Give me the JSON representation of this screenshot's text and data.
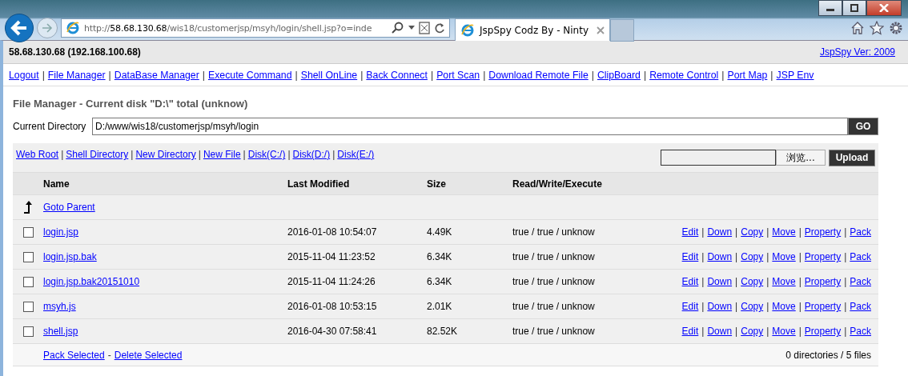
{
  "browser": {
    "url_prefix": "http://",
    "url_host": "58.68.130.68",
    "url_path": "/wis18/customerjsp/msyh/login/shell.jsp?o=inde",
    "tab_title": "JspSpy Codz By - Ninty"
  },
  "header": {
    "host": "58.68.130.68 (192.168.100.68)",
    "version_link": "JspSpy Ver: 2009"
  },
  "separators": {
    "nav": "|",
    "toolbar": "|",
    "actions": "|",
    "footer": "-"
  },
  "nav_links": [
    "Logout",
    "File Manager",
    "DataBase Manager",
    "Execute Command",
    "Shell OnLine",
    "Back Connect",
    "Port Scan",
    "Download Remote File",
    "ClipBoard",
    "Remote Control",
    "Port Map",
    "JSP Env"
  ],
  "title": "File Manager - Current disk \"D:\\\" total (unknow)",
  "current_directory": {
    "label": "Current Directory",
    "value": "D:/www/wis18/customerjsp/msyh/login",
    "button": "GO"
  },
  "toolbar_links": [
    "Web Root",
    "Shell Directory",
    "New Directory",
    "New File",
    "Disk(C:/)",
    "Disk(D:/)",
    "Disk(E:/)"
  ],
  "upload": {
    "browse_button": "浏览...",
    "upload_button": "Upload"
  },
  "table": {
    "columns": [
      "Name",
      "Last Modified",
      "Size",
      "Read/Write/Execute"
    ],
    "parent_link": "Goto Parent",
    "rows": [
      {
        "name": "login.jsp",
        "modified": "2016-01-08 10:54:07",
        "size": "4.49K",
        "rwx": "true / true / unknow",
        "checked": false,
        "actions": [
          "Edit",
          "Down",
          "Copy",
          "Move",
          "Property",
          "Pack"
        ]
      },
      {
        "name": "login.jsp.bak",
        "modified": "2015-11-04 11:23:52",
        "size": "6.34K",
        "rwx": "true / true / unknow",
        "checked": false,
        "actions": [
          "Edit",
          "Down",
          "Copy",
          "Move",
          "Property",
          "Pack"
        ]
      },
      {
        "name": "login.jsp.bak20151010",
        "modified": "2015-11-04 11:24:26",
        "size": "6.34K",
        "rwx": "true / true / unknow",
        "checked": false,
        "actions": [
          "Edit",
          "Down",
          "Copy",
          "Move",
          "Property",
          "Pack"
        ]
      },
      {
        "name": "msyh.js",
        "modified": "2016-01-08 10:53:15",
        "size": "2.01K",
        "rwx": "true / true / unknow",
        "checked": false,
        "actions": [
          "Edit",
          "Down",
          "Copy",
          "Move",
          "Property",
          "Pack"
        ]
      },
      {
        "name": "shell.jsp",
        "modified": "2016-04-30 07:58:41",
        "size": "82.52K",
        "rwx": "true / true / unknow",
        "checked": false,
        "actions": [
          "Edit",
          "Down",
          "Copy",
          "Move",
          "Property",
          "Pack"
        ]
      }
    ],
    "footer_links": [
      "Pack Selected",
      "Delete Selected"
    ],
    "summary": "0 directories / 5 files"
  }
}
